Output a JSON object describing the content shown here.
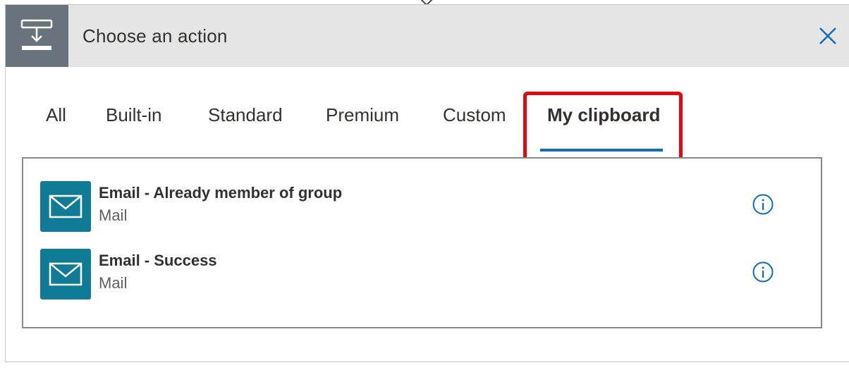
{
  "header": {
    "title": "Choose an action",
    "icon": "data-operation-icon",
    "icon_bg": "#68737d",
    "background": "#e5e5e5"
  },
  "tabs": [
    {
      "label": "All"
    },
    {
      "label": "Built-in"
    },
    {
      "label": "Standard"
    },
    {
      "label": "Premium"
    },
    {
      "label": "Custom"
    },
    {
      "label": "My clipboard",
      "active": true
    }
  ],
  "accent_color": "#0f6cbd",
  "highlight_color": "#e30613",
  "actions": [
    {
      "title": "Email - Already member of group",
      "connector": "Mail",
      "icon": "mail-icon",
      "tile_color": "#0f7b96"
    },
    {
      "title": "Email - Success",
      "connector": "Mail",
      "icon": "mail-icon",
      "tile_color": "#0f7b96"
    }
  ]
}
